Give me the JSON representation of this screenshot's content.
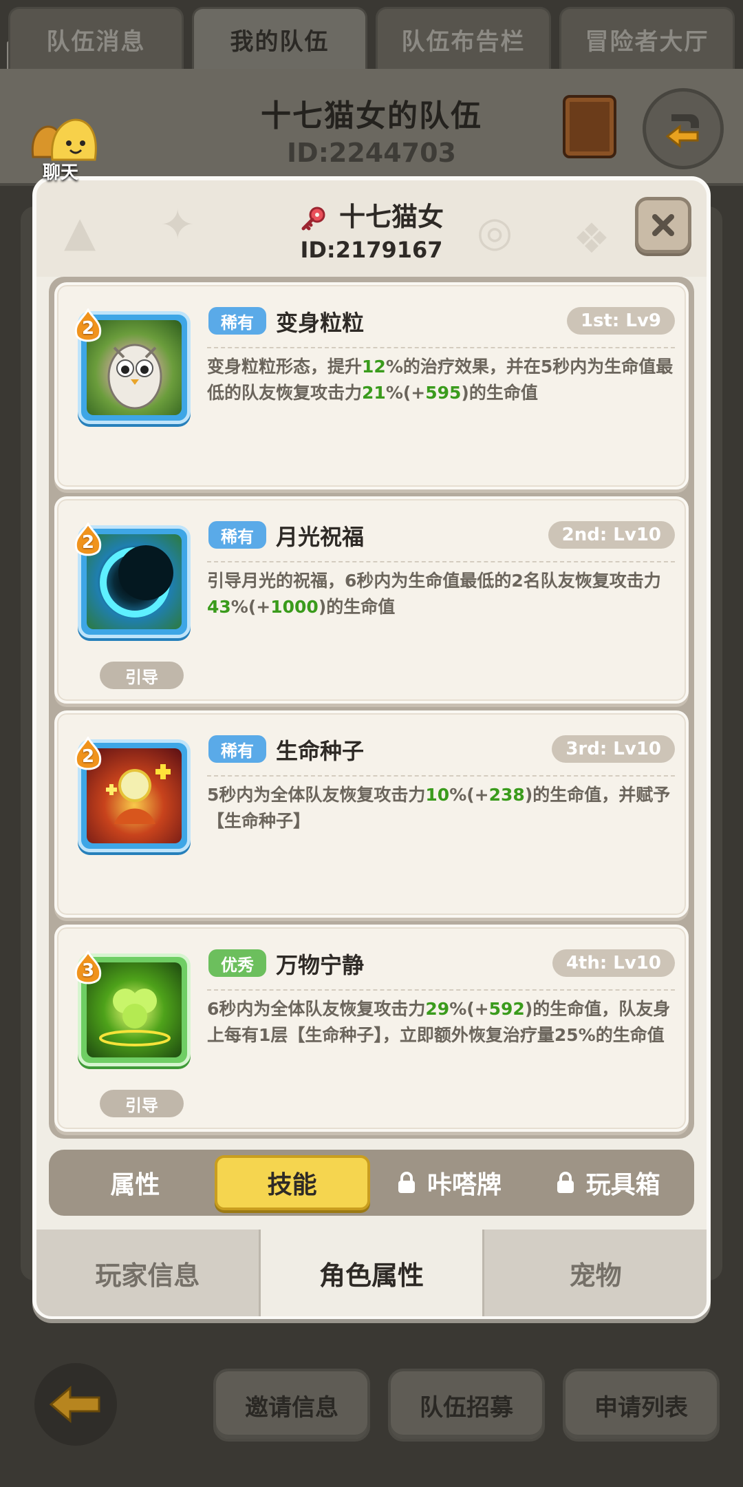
{
  "top_tabs": [
    {
      "label": "队伍消息",
      "active": false
    },
    {
      "label": "我的队伍",
      "active": true
    },
    {
      "label": "队伍布告栏",
      "active": false
    },
    {
      "label": "冒险者大厅",
      "active": false
    }
  ],
  "team": {
    "name": "十七猫女的队伍",
    "id": "ID:2244703"
  },
  "chat": {
    "label": "聊天"
  },
  "modal": {
    "character_name": "十七猫女",
    "character_id": "ID:2179167",
    "skills": [
      {
        "level": "2",
        "rarity": "稀有",
        "name": "变身粒粒",
        "slot": "1st: Lv9",
        "desc": [
          "变身粒粒形态，提升",
          "12",
          "%的治疗效果，并在5秒内为生命值最低的队友恢复攻击力",
          "21",
          "%(+",
          "595",
          ")的生命值"
        ],
        "tag": ""
      },
      {
        "level": "2",
        "rarity": "稀有",
        "name": "月光祝福",
        "slot": "2nd: Lv10",
        "desc": [
          "引导月光的祝福，6秒内为生命值最低的2名队友恢复攻击力",
          "43",
          "%(+",
          "1000",
          ")的生命值"
        ],
        "tag": "引导"
      },
      {
        "level": "2",
        "rarity": "稀有",
        "name": "生命种子",
        "slot": "3rd: Lv10",
        "desc": [
          "5秒内为全体队友恢复攻击力",
          "10",
          "%(+",
          "238",
          ")的生命值，并赋予【生命种子】"
        ],
        "tag": ""
      },
      {
        "level": "3",
        "rarity": "优秀",
        "name": "万物宁静",
        "slot": "4th: Lv10",
        "desc": [
          "6秒内为全体队友恢复攻击力",
          "29",
          "%(+",
          "592",
          ")的生命值，队友身上每有1层【生命种子】，立即额外恢复治疗量25%的生命值"
        ],
        "tag": "引导"
      }
    ],
    "sub_tabs": [
      {
        "label": "属性",
        "locked": false,
        "active": false
      },
      {
        "label": "技能",
        "locked": false,
        "active": true
      },
      {
        "label": "咔嗒牌",
        "locked": true,
        "active": false
      },
      {
        "label": "玩具箱",
        "locked": true,
        "active": false
      }
    ],
    "bottom_tabs": [
      {
        "label": "玩家信息",
        "active": false
      },
      {
        "label": "角色属性",
        "active": true
      },
      {
        "label": "宠物",
        "active": false
      }
    ]
  },
  "footer": {
    "buttons": [
      "邀请信息",
      "队伍招募",
      "申请列表"
    ]
  },
  "colors": {
    "accent_yellow": "#f5d54f",
    "rare_blue": "#5aaae8",
    "good_green": "#6cbf5d",
    "number_green": "#3a9b1c"
  }
}
